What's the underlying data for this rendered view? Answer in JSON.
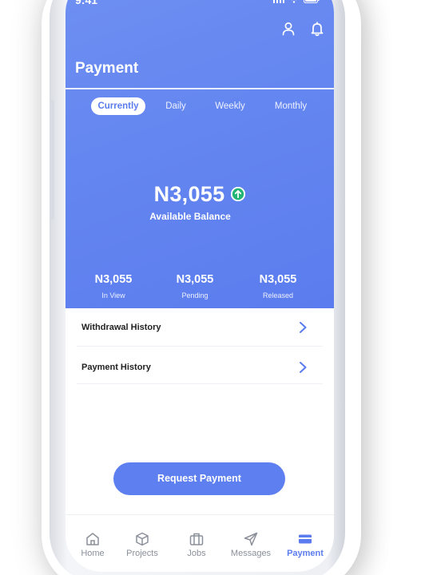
{
  "status_bar": {
    "time": "9:41"
  },
  "header": {
    "title": "Payment"
  },
  "tabs": [
    {
      "label": "Currently",
      "active": true
    },
    {
      "label": "Daily",
      "active": false
    },
    {
      "label": "Weekly",
      "active": false
    },
    {
      "label": "Monthly",
      "active": false
    }
  ],
  "balance": {
    "amount": "N3,055",
    "label": "Available Balance",
    "trend": "up"
  },
  "stats": [
    {
      "value": "N3,055",
      "label": "In View"
    },
    {
      "value": "N3,055",
      "label": "Pending"
    },
    {
      "value": "N3,055",
      "label": "Released"
    }
  ],
  "history": [
    {
      "label": "Withdrawal History"
    },
    {
      "label": "Payment History"
    }
  ],
  "actions": {
    "request_payment": "Request Payment"
  },
  "bottom_nav": [
    {
      "label": "Home",
      "icon": "home-icon"
    },
    {
      "label": "Projects",
      "icon": "box-icon"
    },
    {
      "label": "Jobs",
      "icon": "briefcase-icon"
    },
    {
      "label": "Messages",
      "icon": "send-icon"
    },
    {
      "label": "Payment",
      "icon": "card-icon",
      "active": true
    }
  ],
  "colors": {
    "primary": "#5b7cee",
    "accent_green": "#22b573",
    "text_dark": "#222222",
    "nav_inactive": "#8a8f99"
  }
}
